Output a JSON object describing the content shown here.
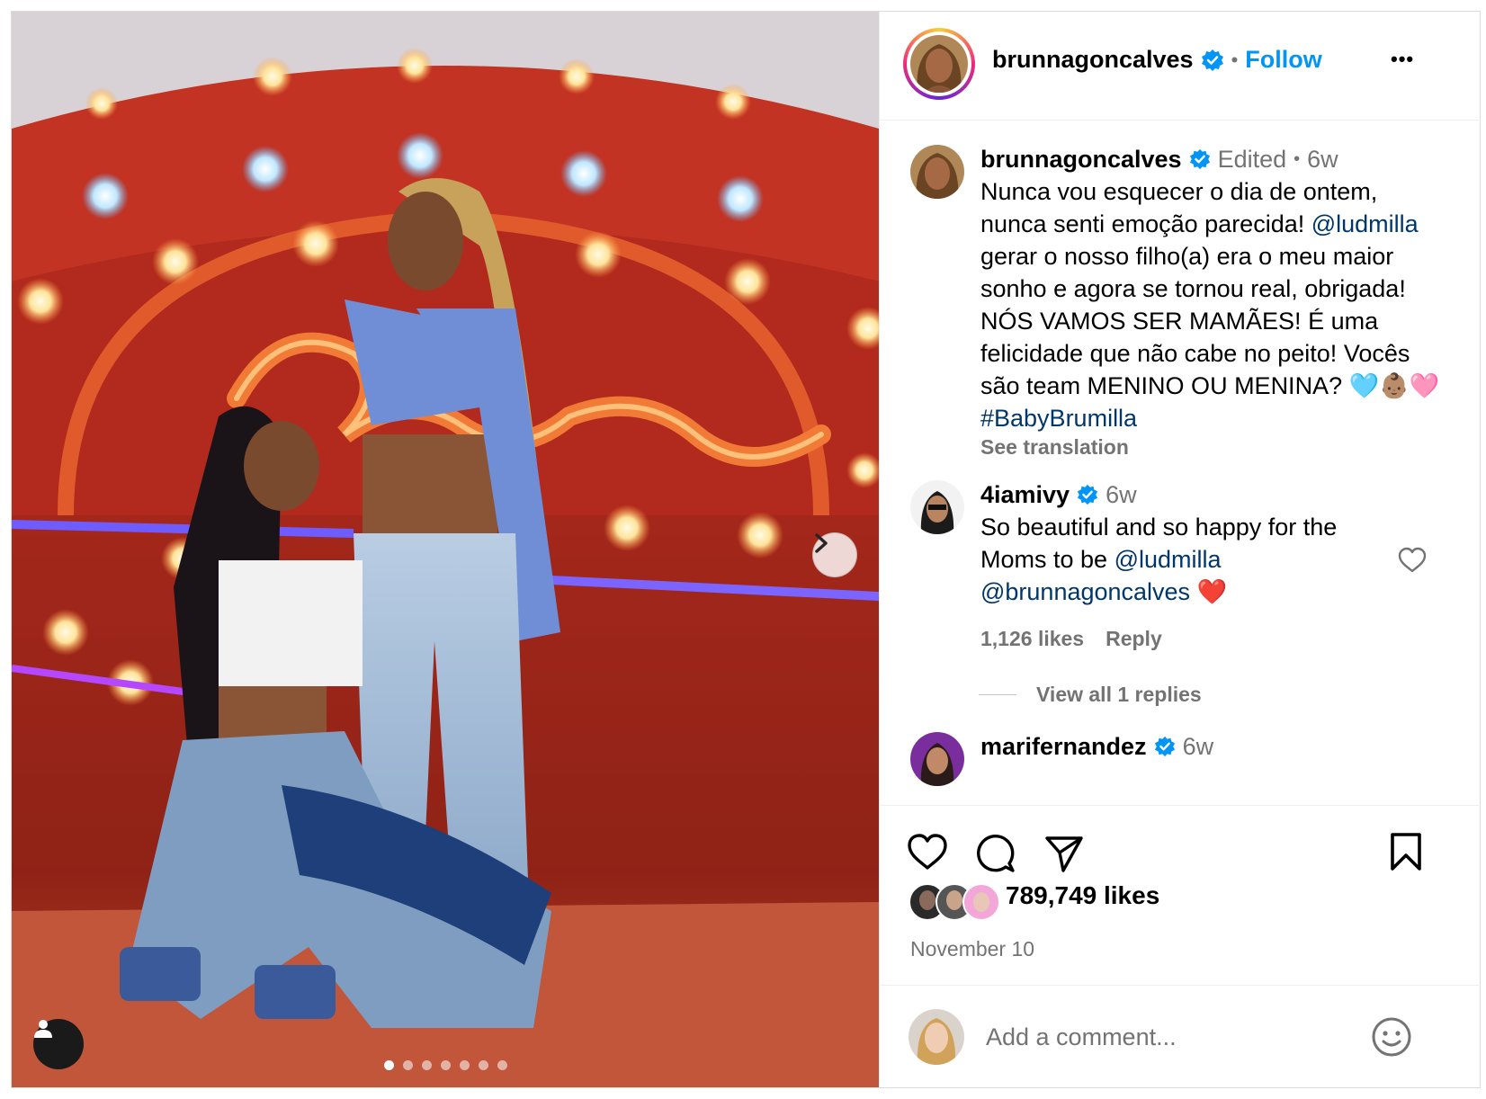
{
  "header": {
    "username": "brunnagoncalves",
    "separator": "•",
    "follow_label": "Follow",
    "more_label": "•••"
  },
  "caption": {
    "username": "brunnagoncalves",
    "edited": "Edited",
    "separator": "•",
    "time": "6w",
    "line1": "Nunca vou esquecer o dia de ontem,",
    "line2_text": "nunca senti emoção parecida! ",
    "line2_mention": "@ludmilla",
    "line3": "gerar o nosso filho(a) era o meu maior",
    "line4": "sonho e agora se tornou real, obrigada!",
    "line5": "NÓS VAMOS SER MAMÃES! É uma",
    "line6": "felicidade que não cabe no peito! Vocês",
    "line7": "são team MENINO OU MENINA? 🩵👶🏽🩷",
    "hashtag": "#BabyBrumilla",
    "see_translation": "See translation"
  },
  "comments": [
    {
      "username": "4iamivy",
      "time": "6w",
      "line1": "So beautiful and so happy for the",
      "line2_text": "Moms to be ",
      "line2_mention": "@ludmilla",
      "line3_mention": "@brunnagoncalves",
      "line3_emoji": "❤️",
      "likes": "1,126 likes",
      "reply_label": "Reply",
      "view_replies": "View all 1 replies"
    },
    {
      "username": "marifernandez",
      "time": "6w"
    }
  ],
  "actions": {
    "likes": "789,749 likes",
    "date": "November 10"
  },
  "add_comment": {
    "placeholder": "Add a comment..."
  },
  "carousel": {
    "total": 7,
    "active": 1
  },
  "colors": {
    "accent": "#0095f6",
    "mention": "#00376b",
    "muted": "#737373",
    "verified": "#0095f6"
  }
}
